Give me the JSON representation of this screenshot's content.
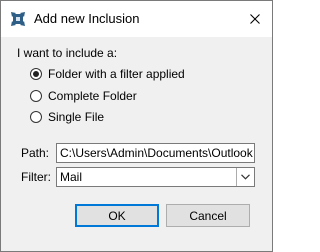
{
  "window": {
    "title": "Add new Inclusion",
    "icon": "gear-cog-icon",
    "close_icon": "close-icon"
  },
  "include_group": {
    "label": "I want to include a:",
    "options": [
      {
        "label": "Folder with a filter applied",
        "selected": true
      },
      {
        "label": "Complete Folder",
        "selected": false
      },
      {
        "label": "Single File",
        "selected": false
      }
    ]
  },
  "path": {
    "label": "Path:",
    "value": "C:\\Users\\Admin\\Documents\\Outlook"
  },
  "filter": {
    "label": "Filter:",
    "value": "Mail",
    "dropdown_icon": "chevron-down-icon"
  },
  "buttons": {
    "ok_label": "OK",
    "cancel_label": "Cancel"
  },
  "colors": {
    "accent": "#0078d7",
    "body_background": "#f0f0f0",
    "button_face": "#e1e1e1"
  }
}
